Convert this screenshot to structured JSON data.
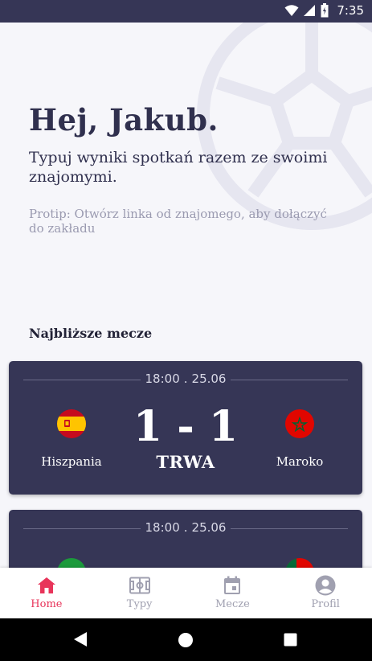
{
  "status_bar": {
    "time": "7:35"
  },
  "home": {
    "greeting": "Hej, Jakub.",
    "subtitle": "Typuj wyniki spotkań razem ze swoimi znajomymi.",
    "protip": "Protip: Otwórz linka od znajomego, aby dołączyć do zakładu",
    "section_title": "Najbliższe mecze"
  },
  "matches": [
    {
      "time": "18:00",
      "date": "25.06",
      "home_team": "Hiszpania",
      "away_team": "Maroko",
      "score": "1 - 1",
      "status": "TRWA",
      "home_flag": "spain-flag",
      "away_flag": "morocco-flag"
    },
    {
      "time": "18:00",
      "date": "25.06",
      "home_team": "",
      "away_team": "",
      "score": "",
      "status": "",
      "home_flag": "saudi-arabia-flag",
      "away_flag": "portugal-flag"
    }
  ],
  "bottom_nav": {
    "items": [
      {
        "label": "Home",
        "icon": "home-icon",
        "active": true
      },
      {
        "label": "Typy",
        "icon": "pitch-icon",
        "active": false
      },
      {
        "label": "Mecze",
        "icon": "calendar-icon",
        "active": false
      },
      {
        "label": "Profil",
        "icon": "account-icon",
        "active": false
      }
    ]
  },
  "colors": {
    "card_bg": "#363656",
    "accent": "#e8345a",
    "text_dark": "#30304e",
    "muted": "#9a9ab0"
  }
}
